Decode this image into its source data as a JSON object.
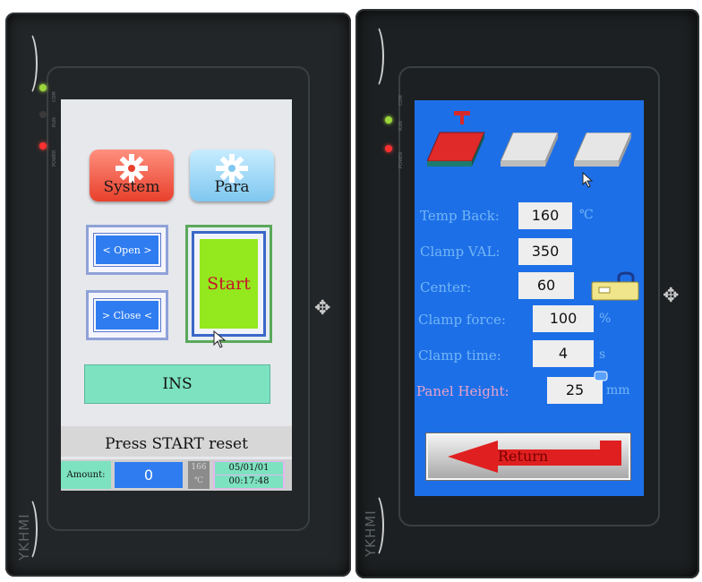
{
  "device": {
    "brand": "YKHMI",
    "led_labels": [
      "COM",
      "RUN",
      "POWER"
    ]
  },
  "left_screen": {
    "system_label": "System",
    "para_label": "Para",
    "open_label": "< Open >",
    "close_label": "> Close <",
    "start_label": "Start",
    "ins_label": "INS",
    "status_message": "Press START reset",
    "amount_label": "Amount:",
    "amount_value": "0",
    "temperature": "166",
    "temp_unit": "℃",
    "date": "05/01/01",
    "time": "00:17:48"
  },
  "right_screen": {
    "params": [
      {
        "label": "Temp Back:",
        "value": "160",
        "unit": "℃"
      },
      {
        "label": "Clamp VAL:",
        "value": "350",
        "unit": ""
      },
      {
        "label": "Center:",
        "value": "60",
        "unit": ""
      },
      {
        "label": "Clamp force:",
        "value": "100",
        "unit": "%"
      },
      {
        "label": "Clamp time:",
        "value": "4",
        "unit": "s"
      },
      {
        "label": "Panel Height:",
        "value": "25",
        "unit": "mm"
      }
    ],
    "return_label": "Return"
  },
  "colors": {
    "right_bg": "#1d6fe8",
    "start_green": "#94e81e",
    "mint": "#7de2c0",
    "blue_btn": "#2f7cf0"
  }
}
